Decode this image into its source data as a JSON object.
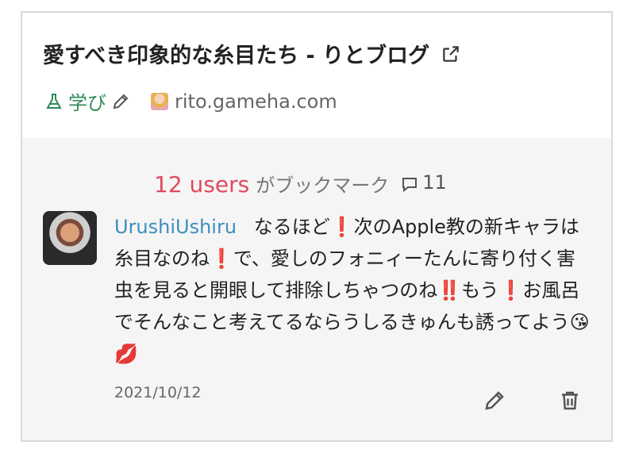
{
  "entry": {
    "title": "愛すべき印象的な糸目たち - りとブログ",
    "category": "学び",
    "site": "rito.gameha.com"
  },
  "bookmarks": {
    "users": "12 users",
    "suffix": "がブックマーク",
    "comment_count": "11"
  },
  "comment": {
    "username": "UrushiUshiru",
    "segments": [
      " なるほど",
      "❗",
      "次のApple教の新キャラは糸目なのね",
      "❗",
      "で、愛しのフォニィーたんに寄り付く害虫を見ると開眼して排除しちゃつのね",
      "‼️",
      "もう",
      "❗",
      "お風呂でそんなこと考えてるならうしるきゅんも誘ってよう😘💋"
    ],
    "date": "2021/10/12"
  },
  "icons": {
    "external": "external-link-icon",
    "category": "flask-icon",
    "edit": "pencil-icon",
    "delete": "trash-icon",
    "comments": "speech-bubble-icon"
  },
  "colors": {
    "users": "#e2495f",
    "username": "#3a8fbf",
    "category": "#2e8b57",
    "panel": "#f5f5f5"
  }
}
